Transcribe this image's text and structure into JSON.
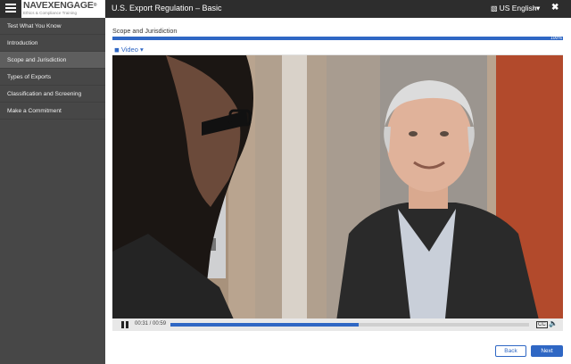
{
  "header": {
    "logo_text": "NAVEXENGAGE",
    "logo_reg": "®",
    "logo_tagline": "Ethics & Compliance Training",
    "course_title": "U.S. Export Regulation – Basic",
    "language": "US English",
    "icons": [
      "menu-icon",
      "language-icon",
      "document-icon",
      "close-icon"
    ]
  },
  "sidebar": {
    "items": [
      {
        "label": "Test What You Know",
        "active": false
      },
      {
        "label": "Introduction",
        "active": false
      },
      {
        "label": "Scope and Jurisdiction",
        "active": true
      },
      {
        "label": "Types of Exports",
        "active": false
      },
      {
        "label": "Classification and Screening",
        "active": false
      },
      {
        "label": "Make a Commitment",
        "active": false
      }
    ]
  },
  "main": {
    "section_title": "Scope and Jurisdiction",
    "progress": {
      "percent": 100,
      "label": "100%"
    },
    "media_tab": {
      "label": "Video",
      "caret": "▾"
    },
    "video": {
      "elapsed": "00:31",
      "duration": "00:59",
      "time_display": "00:31 / 00:59",
      "cc_label": "CC"
    }
  },
  "footer": {
    "back_label": "Back",
    "next_label": "Next"
  },
  "colors": {
    "accent": "#2f67c4",
    "header_bg": "#2d2d2d",
    "sidebar_bg": "#474747",
    "sidebar_active": "#5e5e5e"
  }
}
